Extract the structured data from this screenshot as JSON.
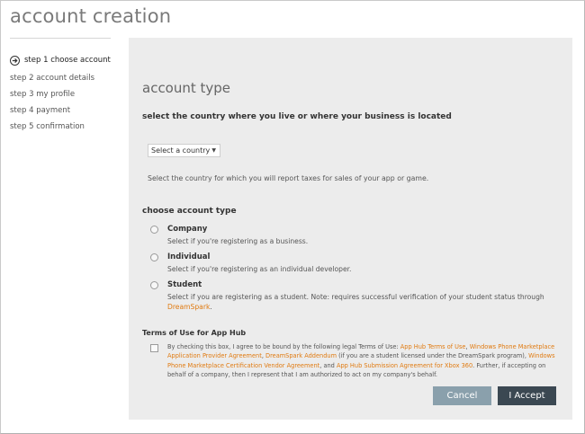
{
  "page": {
    "title": "account creation"
  },
  "steps": [
    {
      "label": "step 1 choose account",
      "current": true
    },
    {
      "label": "step 2 account details"
    },
    {
      "label": "step 3 my profile"
    },
    {
      "label": "step 4 payment"
    },
    {
      "label": "step 5 confirmation"
    }
  ],
  "form": {
    "heading": "account type",
    "country_question": "select the country where you live or where your business is located",
    "country_select": {
      "value": "Select a country"
    },
    "country_help": "Select the country for which you will report taxes for sales of your app or game.",
    "choose_heading": "choose account type",
    "options": [
      {
        "label": "Company",
        "desc": "Select if you're registering as a business."
      },
      {
        "label": "Individual",
        "desc": "Select if you're registering as an individual developer."
      },
      {
        "label": "Student",
        "desc": "Select if you are registering as a student. Note: requires successful verification of your student status through ",
        "link": "DreamSpark",
        "desc_end": "."
      }
    ]
  },
  "terms": {
    "heading": "Terms of Use for App Hub",
    "t1": "By checking this box, I agree to be bound by the following legal Terms of Use: ",
    "l1": "App Hub Terms of Use",
    "t2": ", ",
    "l2": "Windows Phone Marketplace Application Provider Agreement",
    "t3": ", ",
    "l3": "DreamSpark Addendum",
    "t4": " (if you are a student licensed under the DreamSpark program), ",
    "l4": "Windows Phone Marketplace Certification Vendor Agreement",
    "t5": ", and ",
    "l5": "App Hub Submission Agreement for Xbox 360",
    "t6": ". Further, if accepting on behalf of a company, then I represent that I am authorized to act on my company's behalf."
  },
  "buttons": {
    "cancel": "Cancel",
    "accept": "I Accept"
  },
  "colors": {
    "panel": "#ececec",
    "link": "#e07a10",
    "cancel": "#8aa0ac",
    "accept": "#3b4852"
  }
}
